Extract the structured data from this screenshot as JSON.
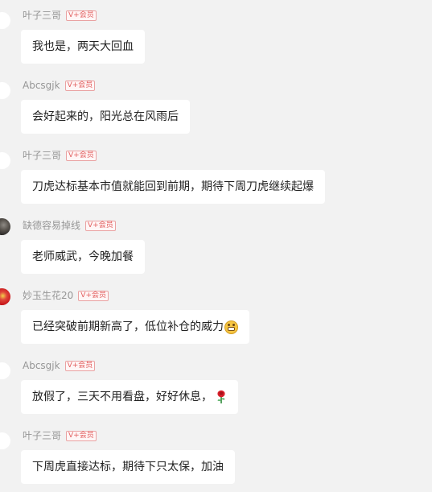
{
  "messages": [
    {
      "username": "叶子三哥",
      "badge": "V+会员",
      "text": "我也是，两天大回血",
      "avatar": "blank-avatar"
    },
    {
      "username": "Abcsgjk",
      "badge": "V+会员",
      "text": "会好起来的，阳光总在风雨后",
      "avatar": "blank-avatar"
    },
    {
      "username": "叶子三哥",
      "badge": "V+会员",
      "text": "刀虎达标基本市值就能回到前期，期待下周刀虎继续起爆",
      "avatar": "blank-avatar"
    },
    {
      "username": "缺德容易掉线",
      "badge": "V+会员",
      "text": "老师威武，今晚加餐",
      "avatar": "dark-photo-avatar"
    },
    {
      "username": "妙玉生花20",
      "badge": "V+会员",
      "text": "已经突破前期新高了，低位补仓的威力",
      "emoji": "grin-emoji",
      "avatar": "red-floral-avatar"
    },
    {
      "username": "Abcsgjk",
      "badge": "V+会员",
      "text": "放假了，三天不用看盘，好好休息，",
      "emoji": "rose-emoji",
      "avatar": "blank-avatar"
    },
    {
      "username": "叶子三哥",
      "badge": "V+会员",
      "text": "下周虎直接达标，期待下只太保，加油",
      "avatar": "blank-avatar"
    }
  ]
}
